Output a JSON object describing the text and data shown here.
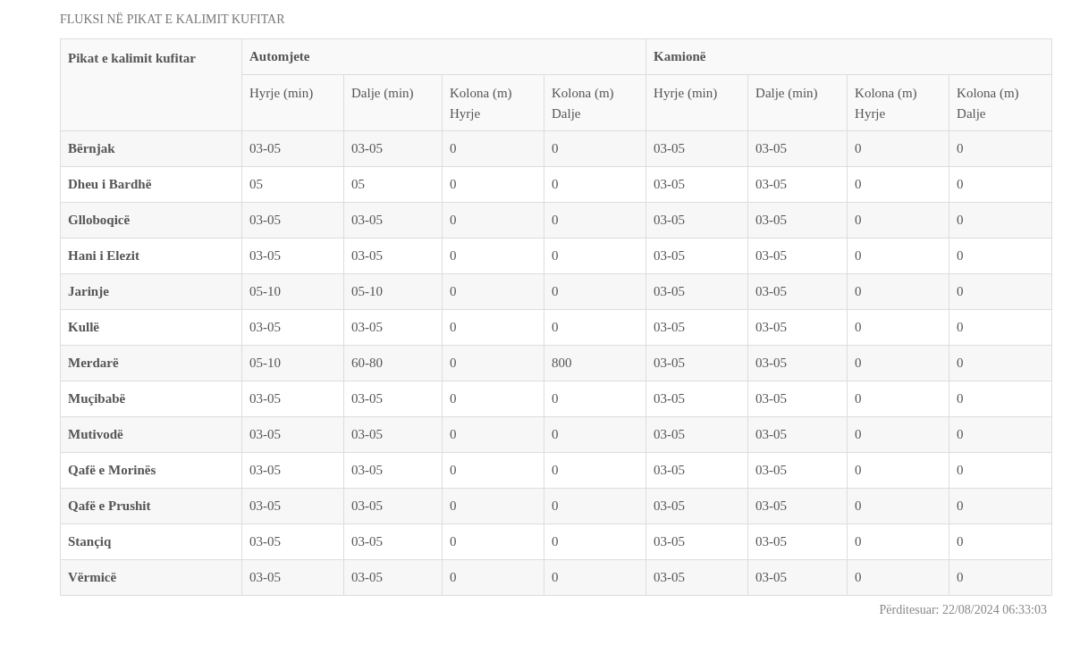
{
  "title": "FLUKSI NË PIKAT E KALIMIT KUFITAR",
  "table": {
    "corner": "Pikat e kalimit kufitar",
    "groups": [
      "Automjete",
      "Kamionë"
    ],
    "columns": [
      "Hyrje (min)",
      "Dalje (min)",
      "Kolona (m) Hyrje",
      "Kolona (m) Dalje",
      "Hyrje (min)",
      "Dalje (min)",
      "Kolona (m) Hyrje",
      "Kolona (m) Dalje"
    ],
    "rows": [
      {
        "name": "Bërnjak",
        "cells": [
          "03-05",
          "03-05",
          "0",
          "0",
          "03-05",
          "03-05",
          "0",
          "0"
        ]
      },
      {
        "name": "Dheu i Bardhë",
        "cells": [
          "05",
          "05",
          "0",
          "0",
          "03-05",
          "03-05",
          "0",
          "0"
        ]
      },
      {
        "name": "Glloboqicë",
        "cells": [
          "03-05",
          "03-05",
          "0",
          "0",
          "03-05",
          "03-05",
          "0",
          "0"
        ]
      },
      {
        "name": "Hani i Elezit",
        "cells": [
          "03-05",
          "03-05",
          "0",
          "0",
          "03-05",
          "03-05",
          "0",
          "0"
        ]
      },
      {
        "name": "Jarinje",
        "cells": [
          "05-10",
          "05-10",
          "0",
          "0",
          "03-05",
          "03-05",
          "0",
          "0"
        ]
      },
      {
        "name": "Kullë",
        "cells": [
          "03-05",
          "03-05",
          "0",
          "0",
          "03-05",
          "03-05",
          "0",
          "0"
        ]
      },
      {
        "name": "Merdarë",
        "cells": [
          "05-10",
          "60-80",
          "0",
          "800",
          "03-05",
          "03-05",
          "0",
          "0"
        ]
      },
      {
        "name": "Muçibabë",
        "cells": [
          "03-05",
          "03-05",
          "0",
          "0",
          "03-05",
          "03-05",
          "0",
          "0"
        ]
      },
      {
        "name": "Mutivodë",
        "cells": [
          "03-05",
          "03-05",
          "0",
          "0",
          "03-05",
          "03-05",
          "0",
          "0"
        ]
      },
      {
        "name": "Qafë e Morinës",
        "cells": [
          "03-05",
          "03-05",
          "0",
          "0",
          "03-05",
          "03-05",
          "0",
          "0"
        ]
      },
      {
        "name": "Qafë e Prushit",
        "cells": [
          "03-05",
          "03-05",
          "0",
          "0",
          "03-05",
          "03-05",
          "0",
          "0"
        ]
      },
      {
        "name": "Stançiq",
        "cells": [
          "03-05",
          "03-05",
          "0",
          "0",
          "03-05",
          "03-05",
          "0",
          "0"
        ]
      },
      {
        "name": "Vërmicë",
        "cells": [
          "03-05",
          "03-05",
          "0",
          "0",
          "03-05",
          "03-05",
          "0",
          "0"
        ]
      }
    ]
  },
  "updated": "Përditesuar: 22/08/2024 06:33:03"
}
